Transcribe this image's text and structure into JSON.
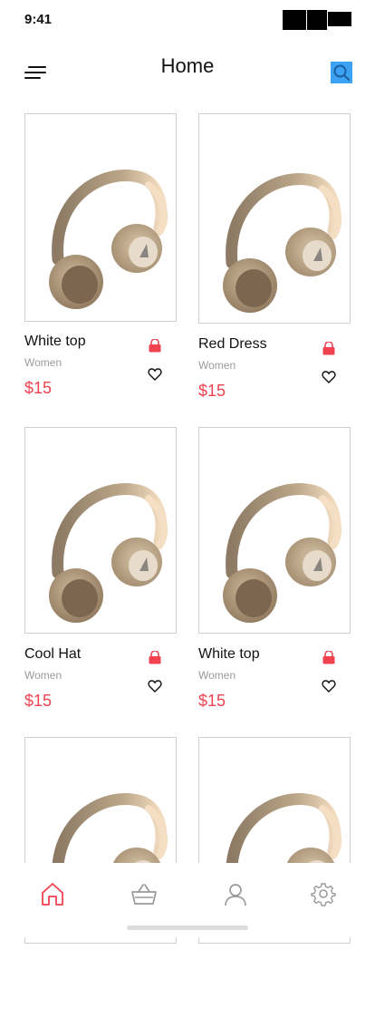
{
  "status_bar": {
    "time": "9:41"
  },
  "header": {
    "title": "Home",
    "menu_icon": "menu-icon",
    "search_icon": "search-icon",
    "accent_color": "#3ca3f4"
  },
  "products": [
    {
      "name": "White top",
      "category": "Women",
      "price": "$15"
    },
    {
      "name": "Red Dress",
      "category": "Women",
      "price": "$15"
    },
    {
      "name": "Cool Hat",
      "category": "Women",
      "price": "$15"
    },
    {
      "name": "White top",
      "category": "Women",
      "price": "$15"
    },
    {
      "name": "",
      "category": "",
      "price": ""
    },
    {
      "name": "",
      "category": "",
      "price": ""
    }
  ],
  "colors": {
    "price": "#f0424f",
    "cart": "#f0424f",
    "active_nav": "#f0424f",
    "inactive_nav": "#9a9a9a"
  },
  "bottom_nav": [
    {
      "icon": "home-icon",
      "active": true
    },
    {
      "icon": "basket-icon",
      "active": false
    },
    {
      "icon": "user-icon",
      "active": false
    },
    {
      "icon": "settings-icon",
      "active": false
    }
  ]
}
